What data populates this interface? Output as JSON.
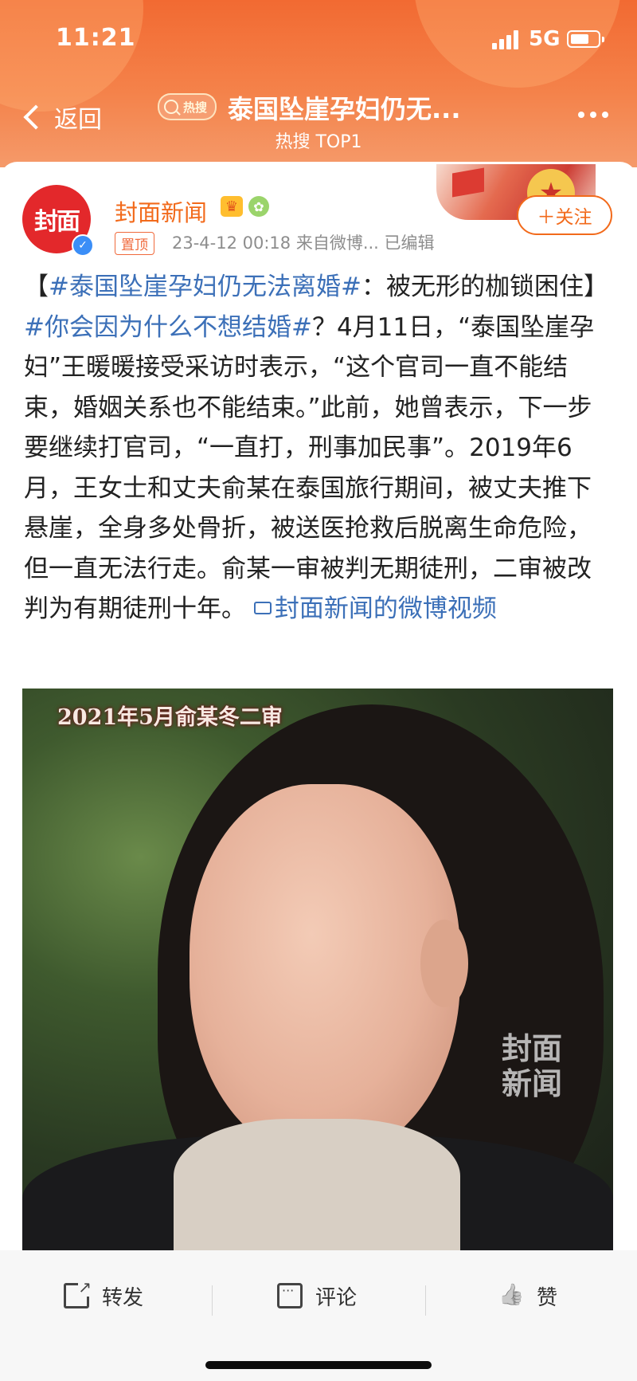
{
  "status_bar": {
    "time": "11:21",
    "network": "5G"
  },
  "nav": {
    "back_label": "返回",
    "hot_badge": "热搜",
    "title": "泰国坠崖孕妇仍无...",
    "subtitle": "热搜 TOP1",
    "more_icon": "ellipsis-icon"
  },
  "post": {
    "avatar_text": "封面",
    "username": "封面新闻",
    "pinned_label": "置顶",
    "meta": "23-4-12 00:18  来自微博...  已编辑",
    "follow_label": "＋关注",
    "text": {
      "open_bracket": "【",
      "tag1": "#泰国坠崖孕妇仍无法离婚#",
      "headline_rest": "：被无形的枷锁困住】",
      "tag2": "#你会因为什么不想结婚#",
      "body": "？4月11日，“泰国坠崖孕妇”王暖暖接受采访时表示，“这个官司一直不能结束，婚姻关系也不能结束。”此前，她曾表示，下一步要继续打官司，“一直打，刑事加民事”。2019年6月，王女士和丈夫俞某在泰国旅行期间，被丈夫推下悬崖，全身多处骨折，被送医抢救后脱离生命危险，但一直无法行走。俞某一审被判无期徒刑，二审被改判为有期徒刑十年。",
      "video_link": "封面新闻的微博视频"
    }
  },
  "video": {
    "overlay_text": "2021年5月俞某冬二审",
    "watermark_line1": "封面",
    "watermark_line2": "新闻"
  },
  "actions": {
    "repost": "转发",
    "comment": "评论",
    "like": "赞"
  },
  "colors": {
    "header": "#f26a32",
    "accent": "#f26a1b",
    "link": "#3c70b8"
  }
}
